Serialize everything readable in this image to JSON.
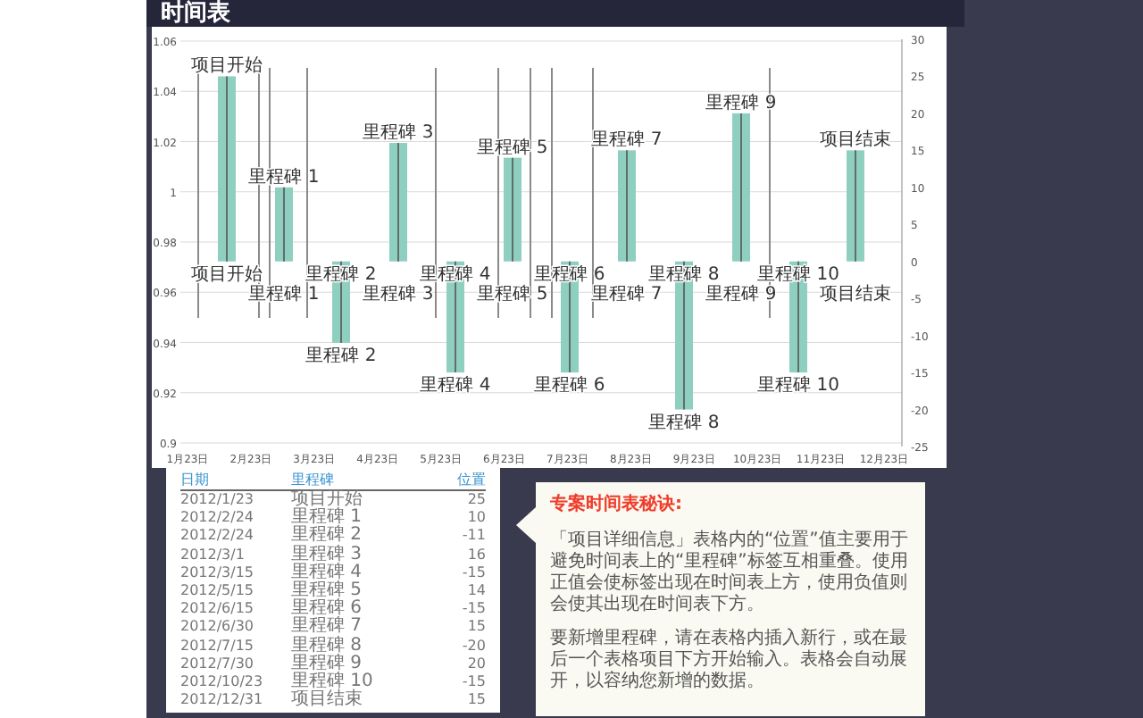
{
  "title": "时间表",
  "chart": {
    "left_axis_ticks": [
      "1.06",
      "1.04",
      "1.02",
      "1",
      "0.98",
      "0.96",
      "0.94",
      "0.92",
      "0.9"
    ],
    "chart_data": {
      "type": "bar",
      "categories": [
        "项目开始",
        "里程碑 1",
        "里程碑 2",
        "里程碑 3",
        "里程碑 4",
        "里程碑 5",
        "里程碑 6",
        "里程碑 7",
        "里程碑 8",
        "里程碑 9",
        "里程碑 10",
        "项目结束"
      ],
      "values": [
        25,
        10,
        -11,
        16,
        -15,
        14,
        -15,
        15,
        -20,
        20,
        -15,
        15
      ],
      "ylim": [
        -25,
        30
      ],
      "yticks": [
        30,
        25,
        20,
        15,
        10,
        5,
        0,
        -5,
        -10,
        -15,
        -20,
        -25
      ]
    },
    "x_axis_labels": [
      "1月23日",
      "2月23日",
      "3月23日",
      "4月23日",
      "5月23日",
      "6月23日",
      "7月23日",
      "8月23日",
      "9月23日",
      "10月23日",
      "11月23日",
      "12月23日"
    ]
  },
  "table": {
    "columns": [
      "日期",
      "里程碑",
      "位置"
    ],
    "rows": [
      [
        "2012/1/23",
        "项目开始",
        "25"
      ],
      [
        "2012/2/24",
        "里程碑 1",
        "10"
      ],
      [
        "2012/2/24",
        "里程碑 2",
        "-11"
      ],
      [
        "2012/3/1",
        "里程碑 3",
        "16"
      ],
      [
        "2012/3/15",
        "里程碑 4",
        "-15"
      ],
      [
        "2012/5/15",
        "里程碑 5",
        "14"
      ],
      [
        "2012/6/15",
        "里程碑 6",
        "-15"
      ],
      [
        "2012/6/30",
        "里程碑 7",
        "15"
      ],
      [
        "2012/7/15",
        "里程碑 8",
        "-20"
      ],
      [
        "2012/7/30",
        "里程碑 9",
        "20"
      ],
      [
        "2012/10/23",
        "里程碑 10",
        "-15"
      ],
      [
        "2012/12/31",
        "项目结束",
        "15"
      ]
    ]
  },
  "tip": {
    "title": "专案时间表秘诀:",
    "paragraphs": [
      "「项目详细信息」表格内的“位置”值主要用于避免时间表上的“里程碑”标签互相重叠。使用正值会使标签出现在时间表上方，使用负值则会使其出现在时间表下方。",
      "要新增里程碑，请在表格内插入新行，或在最后一个表格项目下方开始输入。表格会自动展开，以容纳您新增的数据。"
    ]
  }
}
